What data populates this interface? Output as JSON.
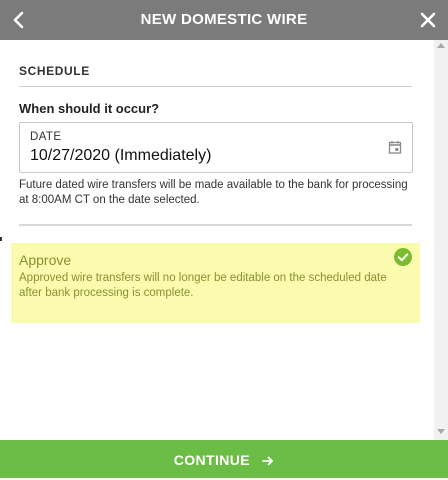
{
  "header": {
    "title": "NEW DOMESTIC WIRE",
    "back_icon": "chevron-left-icon",
    "close_icon": "close-icon"
  },
  "schedule": {
    "section_title": "SCHEDULE",
    "question": "When should it occur?",
    "date_label": "DATE",
    "date_value": "10/27/2020 (Immediately)",
    "date_icon": "calendar-icon",
    "helper_text": "Future dated wire transfers will be made available to the bank for processing at 8:00AM CT on the date selected."
  },
  "approve": {
    "title": "Approve",
    "description": "Approved wire transfers will no longer be editable on the scheduled date after bank processing is complete.",
    "checked": true,
    "check_icon": "check-circle-icon"
  },
  "footer": {
    "continue_label": "CONTINUE",
    "arrow_icon": "arrow-right-icon"
  },
  "colors": {
    "header_bg": "#7b7b7b",
    "continue_bg": "#6cbd45",
    "approve_bg": "#fbfbb0",
    "approve_text": "#8a9030",
    "check_green": "#7cbd2f"
  }
}
